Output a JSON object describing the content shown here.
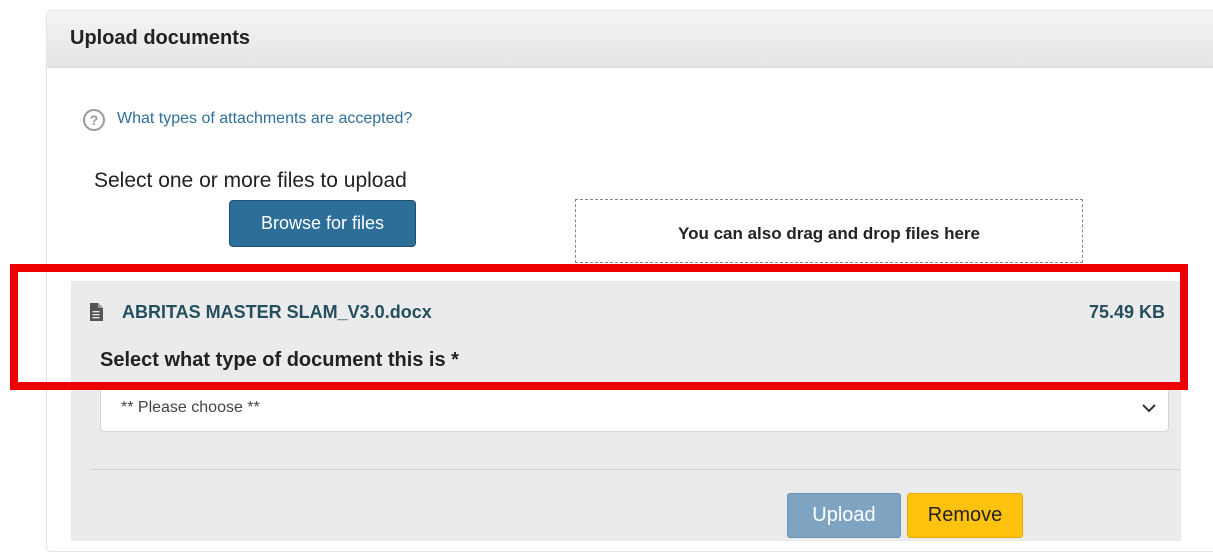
{
  "panel": {
    "title": "Upload documents"
  },
  "help": {
    "icon": "question-circle-icon",
    "link_text": "What types of attachments are accepted?"
  },
  "upload": {
    "select_files_label": "Select one or more files to upload",
    "browse_button_label": "Browse for files",
    "drop_zone_text": "You can also drag and drop files here"
  },
  "file": {
    "icon": "document-icon",
    "name": "ABRITAS MASTER SLAM_V3.0.docx",
    "size": "75.49 KB",
    "doc_type_label": "Select what type of document this is *",
    "doc_type_selected": "** Please choose **",
    "upload_button_label": "Upload",
    "remove_button_label": "Remove"
  },
  "colors": {
    "primary_button": "#2d6e99",
    "upload_button": "#7fa4c1",
    "remove_button": "#ffc20e",
    "highlight": "#ee0000",
    "link": "#2f6f99"
  }
}
